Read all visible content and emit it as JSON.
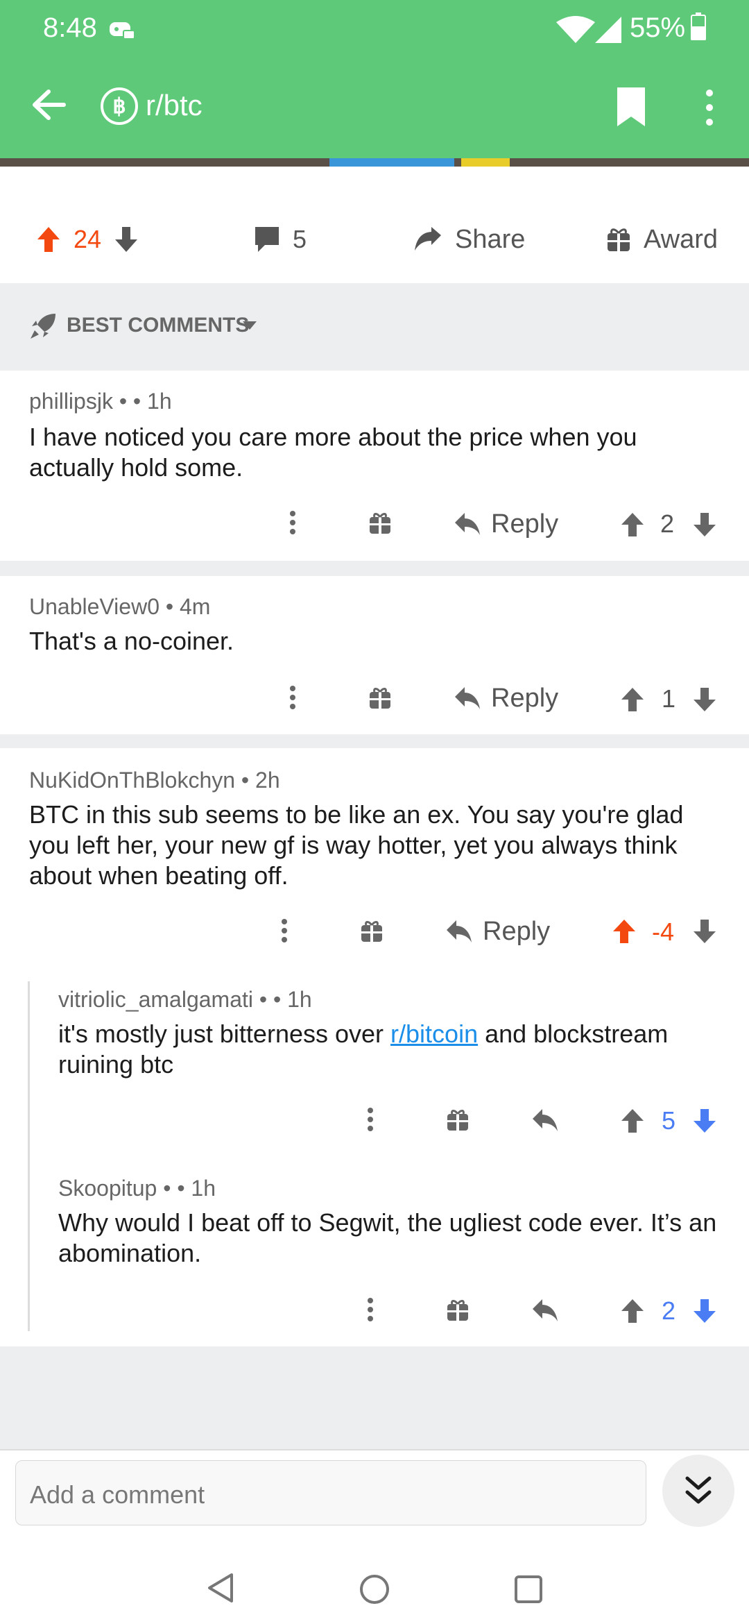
{
  "status_bar": {
    "time": "8:48",
    "battery": "55%"
  },
  "header": {
    "subreddit": "r/btc"
  },
  "post_actions": {
    "score": "24",
    "comments": "5",
    "share_label": "Share",
    "award_label": "Award"
  },
  "sort": {
    "label": "BEST COMMENTS"
  },
  "comments": [
    {
      "author": "phillipsjk",
      "meta": " •  • 1h",
      "body": "I have noticed you care more about the price when you actually hold some.",
      "reply_label": "Reply",
      "score": "2"
    },
    {
      "author": "UnableView0",
      "meta": " • 4m",
      "body": "That's a no-coiner.",
      "reply_label": "Reply",
      "score": "1"
    },
    {
      "author": "NuKidOnThBlokchyn",
      "meta": " • 2h",
      "body": "BTC in this sub seems to be like an ex. You say you're glad you left her, your new gf is way hotter, yet you always think about when beating off.",
      "reply_label": "Reply",
      "score": "-4"
    },
    {
      "author": "vitriolic_amalgamati",
      "meta": " •  • 1h",
      "body_before": "it's mostly just bitterness over ",
      "link": "r/bitcoin",
      "body_after": " and blockstream ruining btc",
      "score": "5"
    },
    {
      "author": "Skoopitup",
      "meta": " •  • 1h",
      "body": "Why would I beat off to Segwit, the ugliest code ever. It’s an abomination.",
      "score": "2"
    }
  ],
  "composer": {
    "placeholder": "Add a comment"
  },
  "colors": {
    "header": "#5fc97a",
    "upvote": "#f3480f",
    "downvote": "#4a7df3",
    "link": "#1a8ee8"
  }
}
